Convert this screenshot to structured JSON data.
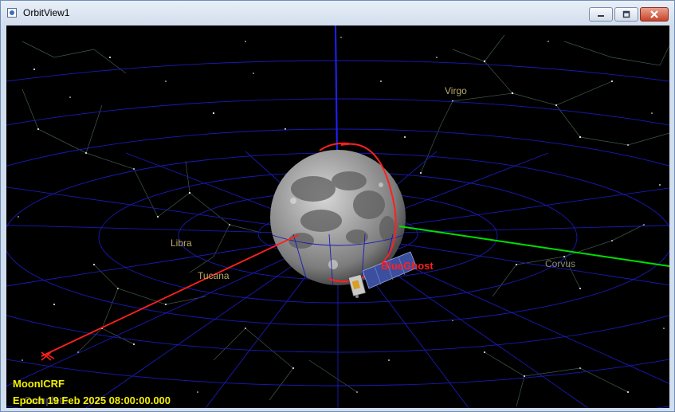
{
  "window": {
    "title": "OrbitView1"
  },
  "constellations": [
    "Virgo",
    "Libra",
    "Tucana",
    "Corvus"
  ],
  "spacecraft": {
    "label": "BlueGhost"
  },
  "hud": {
    "coordinate_system": "MoonICRF",
    "epoch": "Epoch 19 Feb 2025 08:00:00.000",
    "ghost_text": "Complete"
  },
  "colors": {
    "orbit": "#ff2020",
    "x_axis": "#ff2020",
    "y_axis": "#00e000",
    "z_axis": "#2020ff",
    "grid": "#1a1ab8",
    "constellation_label": "#b8a868",
    "hud_text": "#f4f000"
  },
  "icons": {
    "window_icon": "orbitview-icon",
    "minimize": "minimize-icon",
    "maximize": "maximize-icon",
    "close": "close-icon"
  }
}
